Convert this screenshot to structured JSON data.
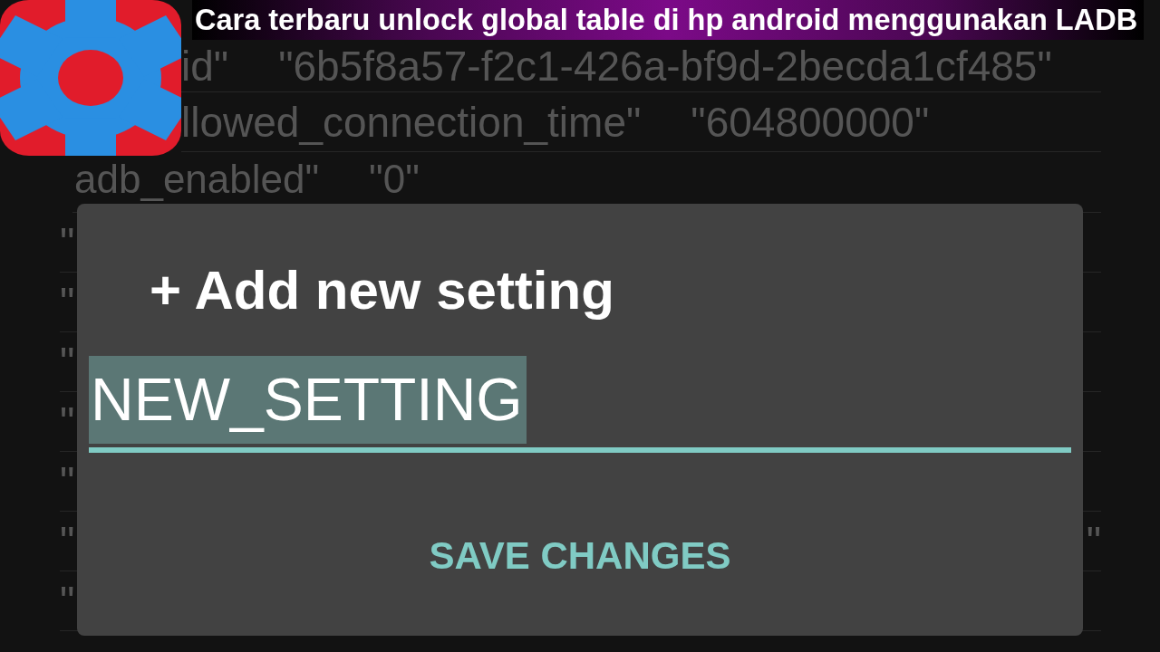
{
  "overlay": {
    "title": "Cara terbaru unlock global table di hp android menggunakan LADB"
  },
  "settings_list": {
    "rows": [
      {
        "key": "id\"",
        "value": "\"6b5f8a57-f2c1-426a-bf9d-2becda1cf485\""
      },
      {
        "key": "llowed_connection_time\"",
        "value": "\"604800000\""
      },
      {
        "key": "adb_enabled\"",
        "value": "\"0\""
      },
      {
        "key": "\""
      },
      {
        "key": "\""
      },
      {
        "key": "\""
      },
      {
        "key": "\""
      },
      {
        "key": "\""
      },
      {
        "key": "\"",
        "value": "\""
      },
      {
        "key": "\""
      }
    ]
  },
  "dialog": {
    "title": "+ Add new setting",
    "field": {
      "value": "NEW_SETTING",
      "focused": true,
      "text_selected": true
    },
    "buttons": [
      {
        "label": "SAVE CHANGES"
      }
    ]
  }
}
